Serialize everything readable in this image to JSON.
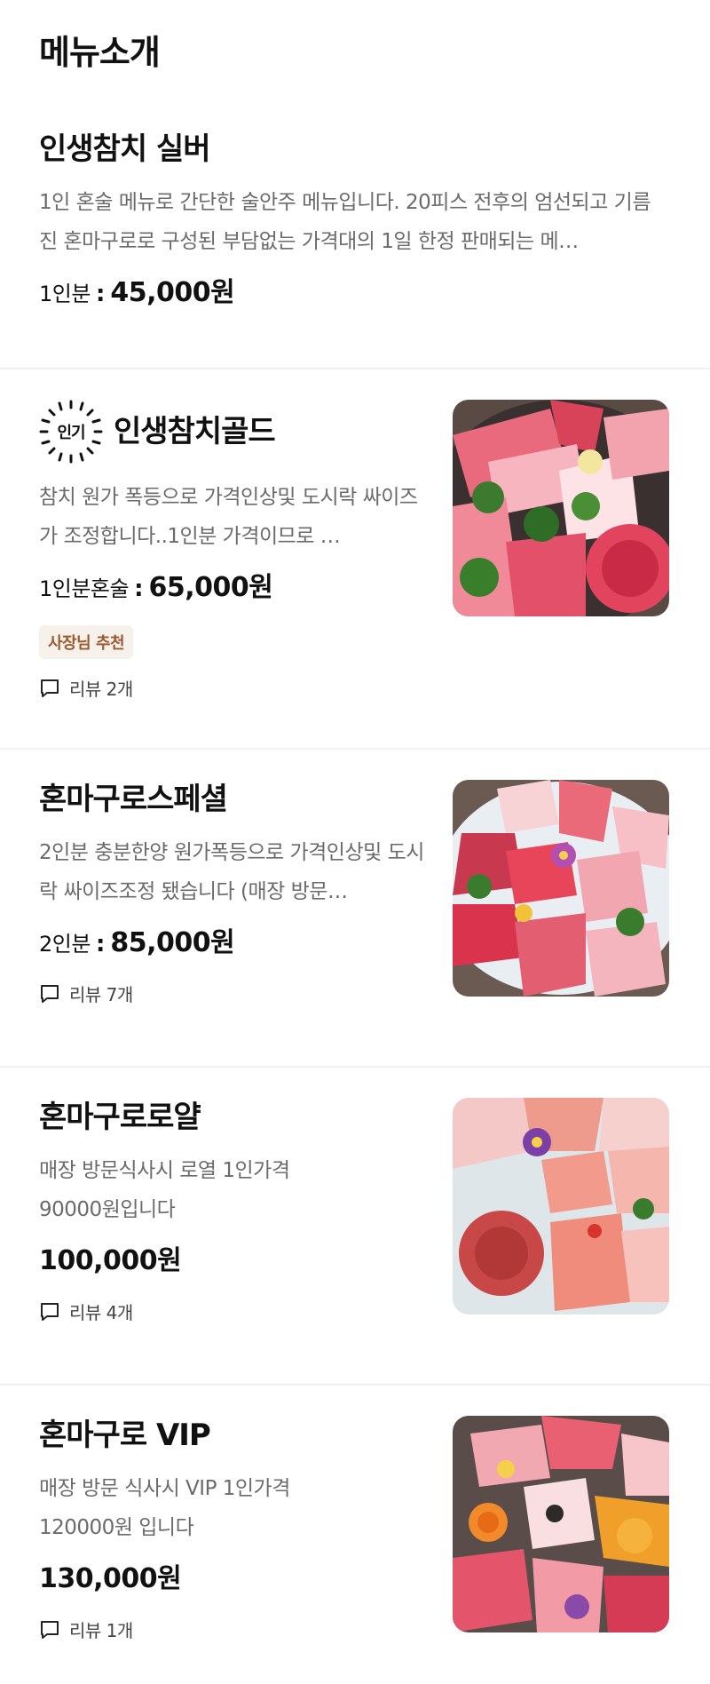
{
  "page": {
    "title": "메뉴소개"
  },
  "popular_badge": {
    "label": "인기"
  },
  "items": [
    {
      "name": "인생참치 실버",
      "description": "1인 혼술 메뉴로 간단한 술안주 메뉴입니다. 20피스 전후의 엄선되고 기름진 혼마구로로 구성된 부담없는 가격대의 1일 한정 판매되는 메…",
      "price_label": "1인분",
      "price": "45,000원"
    },
    {
      "name": "인생참치골드",
      "description": "참치 원가 폭등으로 가격인상및 도시락 싸이즈가 조정합니다..1인분 가격이므로 …",
      "price_label": "1인분혼술",
      "price": "65,000원",
      "badge": "사장님 추천",
      "review": "리뷰 2개"
    },
    {
      "name": "혼마구로스페셜",
      "description": "2인분 충분한양 원가폭등으로 가격인상및 도시락 싸이즈조정 됐습니다 (매장 방문…",
      "price_label": "2인분",
      "price": "85,000원",
      "review": "리뷰 7개"
    },
    {
      "name": "혼마구로로얄",
      "description": "매장 방문식사시 로열 1인가격 90000원입니다",
      "price": "100,000원",
      "review": "리뷰 4개"
    },
    {
      "name": "혼마구로 VIP",
      "description": "매장 방문 식사시 VIP 1인가격 120000원 입니다",
      "price": "130,000원",
      "review": "리뷰 1개"
    }
  ],
  "colors": {
    "badge_bg": "#f6f1ea",
    "badge_text": "#9c5a32",
    "description": "#6b6b6b",
    "divider": "#f0f0f0"
  },
  "icons": {
    "review": "speech-bubble-icon",
    "popular": "sunburst-badge-icon"
  }
}
